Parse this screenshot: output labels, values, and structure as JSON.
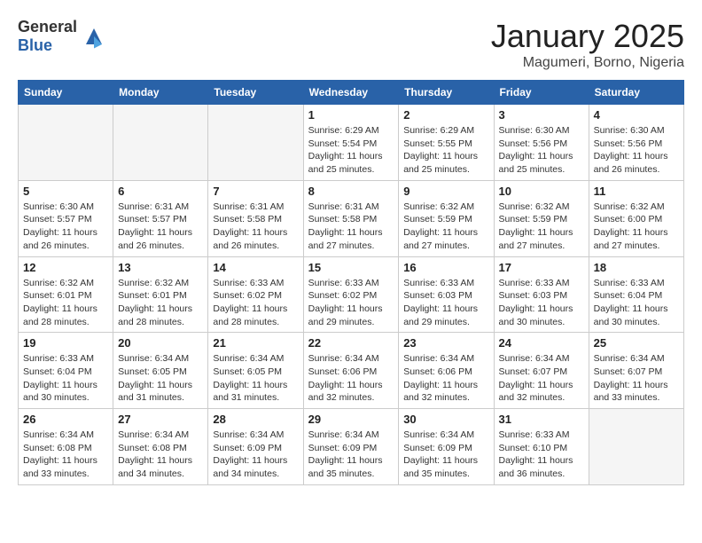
{
  "header": {
    "logo_general": "General",
    "logo_blue": "Blue",
    "month_title": "January 2025",
    "subtitle": "Magumeri, Borno, Nigeria"
  },
  "days_of_week": [
    "Sunday",
    "Monday",
    "Tuesday",
    "Wednesday",
    "Thursday",
    "Friday",
    "Saturday"
  ],
  "weeks": [
    [
      {
        "day": "",
        "info": ""
      },
      {
        "day": "",
        "info": ""
      },
      {
        "day": "",
        "info": ""
      },
      {
        "day": "1",
        "info": "Sunrise: 6:29 AM\nSunset: 5:54 PM\nDaylight: 11 hours and 25 minutes."
      },
      {
        "day": "2",
        "info": "Sunrise: 6:29 AM\nSunset: 5:55 PM\nDaylight: 11 hours and 25 minutes."
      },
      {
        "day": "3",
        "info": "Sunrise: 6:30 AM\nSunset: 5:56 PM\nDaylight: 11 hours and 25 minutes."
      },
      {
        "day": "4",
        "info": "Sunrise: 6:30 AM\nSunset: 5:56 PM\nDaylight: 11 hours and 26 minutes."
      }
    ],
    [
      {
        "day": "5",
        "info": "Sunrise: 6:30 AM\nSunset: 5:57 PM\nDaylight: 11 hours and 26 minutes."
      },
      {
        "day": "6",
        "info": "Sunrise: 6:31 AM\nSunset: 5:57 PM\nDaylight: 11 hours and 26 minutes."
      },
      {
        "day": "7",
        "info": "Sunrise: 6:31 AM\nSunset: 5:58 PM\nDaylight: 11 hours and 26 minutes."
      },
      {
        "day": "8",
        "info": "Sunrise: 6:31 AM\nSunset: 5:58 PM\nDaylight: 11 hours and 27 minutes."
      },
      {
        "day": "9",
        "info": "Sunrise: 6:32 AM\nSunset: 5:59 PM\nDaylight: 11 hours and 27 minutes."
      },
      {
        "day": "10",
        "info": "Sunrise: 6:32 AM\nSunset: 5:59 PM\nDaylight: 11 hours and 27 minutes."
      },
      {
        "day": "11",
        "info": "Sunrise: 6:32 AM\nSunset: 6:00 PM\nDaylight: 11 hours and 27 minutes."
      }
    ],
    [
      {
        "day": "12",
        "info": "Sunrise: 6:32 AM\nSunset: 6:01 PM\nDaylight: 11 hours and 28 minutes."
      },
      {
        "day": "13",
        "info": "Sunrise: 6:32 AM\nSunset: 6:01 PM\nDaylight: 11 hours and 28 minutes."
      },
      {
        "day": "14",
        "info": "Sunrise: 6:33 AM\nSunset: 6:02 PM\nDaylight: 11 hours and 28 minutes."
      },
      {
        "day": "15",
        "info": "Sunrise: 6:33 AM\nSunset: 6:02 PM\nDaylight: 11 hours and 29 minutes."
      },
      {
        "day": "16",
        "info": "Sunrise: 6:33 AM\nSunset: 6:03 PM\nDaylight: 11 hours and 29 minutes."
      },
      {
        "day": "17",
        "info": "Sunrise: 6:33 AM\nSunset: 6:03 PM\nDaylight: 11 hours and 30 minutes."
      },
      {
        "day": "18",
        "info": "Sunrise: 6:33 AM\nSunset: 6:04 PM\nDaylight: 11 hours and 30 minutes."
      }
    ],
    [
      {
        "day": "19",
        "info": "Sunrise: 6:33 AM\nSunset: 6:04 PM\nDaylight: 11 hours and 30 minutes."
      },
      {
        "day": "20",
        "info": "Sunrise: 6:34 AM\nSunset: 6:05 PM\nDaylight: 11 hours and 31 minutes."
      },
      {
        "day": "21",
        "info": "Sunrise: 6:34 AM\nSunset: 6:05 PM\nDaylight: 11 hours and 31 minutes."
      },
      {
        "day": "22",
        "info": "Sunrise: 6:34 AM\nSunset: 6:06 PM\nDaylight: 11 hours and 32 minutes."
      },
      {
        "day": "23",
        "info": "Sunrise: 6:34 AM\nSunset: 6:06 PM\nDaylight: 11 hours and 32 minutes."
      },
      {
        "day": "24",
        "info": "Sunrise: 6:34 AM\nSunset: 6:07 PM\nDaylight: 11 hours and 32 minutes."
      },
      {
        "day": "25",
        "info": "Sunrise: 6:34 AM\nSunset: 6:07 PM\nDaylight: 11 hours and 33 minutes."
      }
    ],
    [
      {
        "day": "26",
        "info": "Sunrise: 6:34 AM\nSunset: 6:08 PM\nDaylight: 11 hours and 33 minutes."
      },
      {
        "day": "27",
        "info": "Sunrise: 6:34 AM\nSunset: 6:08 PM\nDaylight: 11 hours and 34 minutes."
      },
      {
        "day": "28",
        "info": "Sunrise: 6:34 AM\nSunset: 6:09 PM\nDaylight: 11 hours and 34 minutes."
      },
      {
        "day": "29",
        "info": "Sunrise: 6:34 AM\nSunset: 6:09 PM\nDaylight: 11 hours and 35 minutes."
      },
      {
        "day": "30",
        "info": "Sunrise: 6:34 AM\nSunset: 6:09 PM\nDaylight: 11 hours and 35 minutes."
      },
      {
        "day": "31",
        "info": "Sunrise: 6:33 AM\nSunset: 6:10 PM\nDaylight: 11 hours and 36 minutes."
      },
      {
        "day": "",
        "info": ""
      }
    ]
  ]
}
